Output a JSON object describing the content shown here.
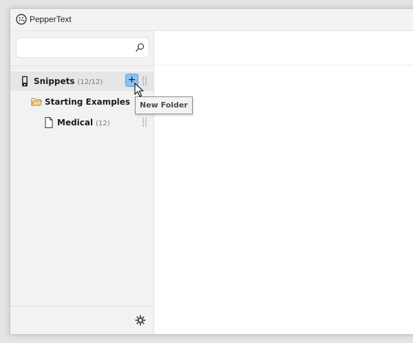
{
  "window": {
    "title": "PepperText"
  },
  "search": {
    "value": "",
    "placeholder": ""
  },
  "tree": {
    "root": {
      "label": "Snippets",
      "count": "(12/12)"
    },
    "folder": {
      "label": "Starting Examples"
    },
    "item": {
      "label": "Medical",
      "count": "(12)"
    }
  },
  "tooltip": {
    "text": "New Folder"
  },
  "add_button": {
    "label": "+"
  },
  "icons": {
    "app": "pepper-icon",
    "search": "search-icon",
    "root": "phone-icon",
    "folder": "folder-open-icon",
    "item": "document-icon",
    "drag": "drag-handle-icon",
    "settings": "gear-icon",
    "cursor": "mouse-pointer-icon"
  },
  "colors": {
    "accent": "#8cc2ef",
    "accent_border": "#5c9bd8",
    "folder": "#d9a43b"
  }
}
